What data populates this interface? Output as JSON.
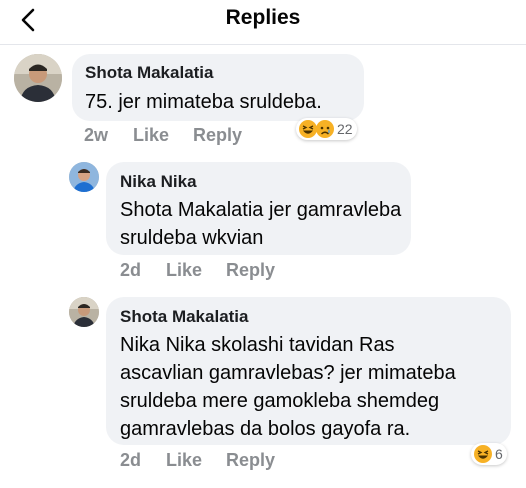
{
  "header": {
    "title": "Replies"
  },
  "comments": [
    {
      "author": "Shota Makalatia",
      "lines": [
        "75. jer mimateba sruldeba."
      ],
      "time": "2w",
      "like": "Like",
      "reply": "Reply",
      "reaction_count": "22",
      "reactions": [
        "haha-icon",
        "sad-icon"
      ]
    },
    {
      "author": "Nika Nika",
      "lines": [
        "Shota Makalatia jer gamravleba",
        "sruldeba wkvian"
      ],
      "time": "2d",
      "like": "Like",
      "reply": "Reply"
    },
    {
      "author": "Shota Makalatia",
      "lines": [
        "Nika Nika skolashi tavidan Ras",
        "ascavlian gamravlebas? jer mimateba",
        "sruldeba mere gamokleba shemdeg",
        "gamravlebas da bolos gayofa ra."
      ],
      "time": "2d",
      "like": "Like",
      "reply": "Reply",
      "reaction_count": "6",
      "reactions": [
        "haha-icon"
      ]
    }
  ],
  "colors": {
    "bubble": "#f0f2f5",
    "meta": "#8a8d91",
    "emoji_yellow": "#f7b125"
  }
}
